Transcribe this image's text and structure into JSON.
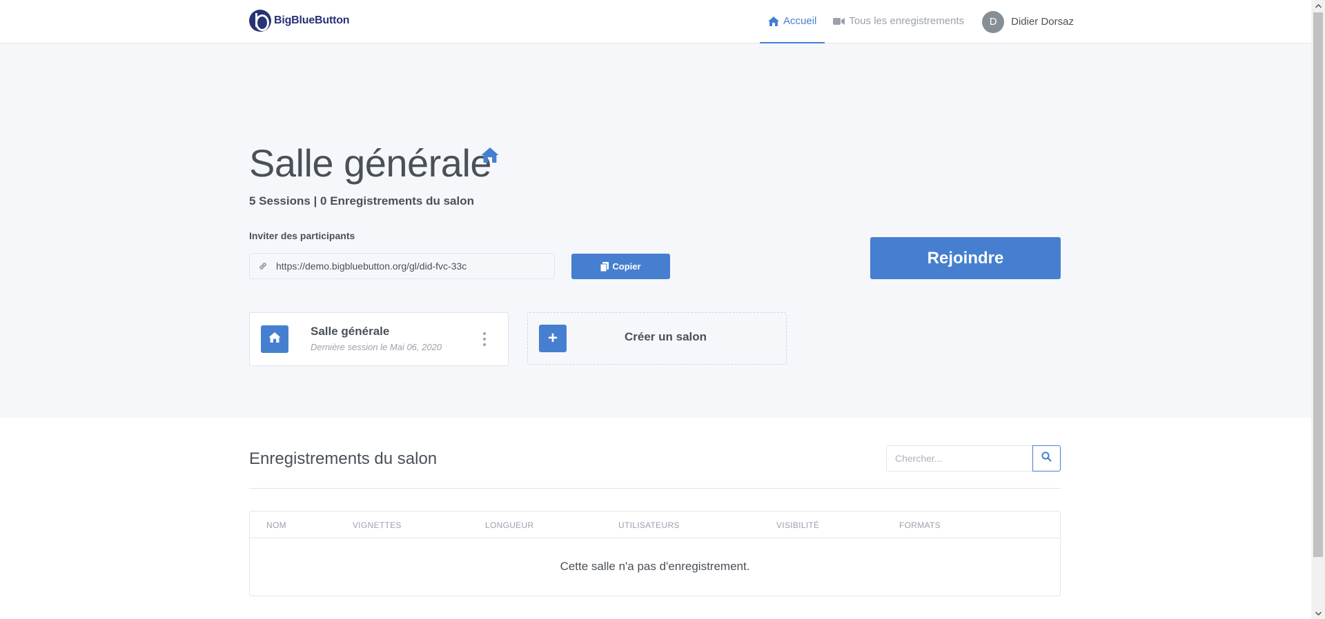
{
  "brand": {
    "name": "BigBlueButton"
  },
  "nav": {
    "home_label": "Accueil",
    "recordings_label": "Tous les enregistrements",
    "user_initial": "D",
    "user_name": "Didier Dorsaz"
  },
  "room": {
    "title": "Salle générale",
    "stats": "5 Sessions | 0 Enregistrements du salon",
    "invite_label": "Inviter des participants",
    "invite_url": "https://demo.bigbluebutton.org/gl/did-fvc-33c",
    "copy_label": "Copier",
    "join_label": "Rejoindre"
  },
  "room_card": {
    "name": "Salle générale",
    "last_session": "Dernière session le Mai 06, 2020"
  },
  "create_room": {
    "label": "Créer un salon",
    "icon_glyph": "+"
  },
  "recordings": {
    "title": "Enregistrements du salon",
    "search_placeholder": "Chercher...",
    "columns": [
      "NOM",
      "VIGNETTES",
      "LONGUEUR",
      "UTILISATEURS",
      "VISIBILITÉ",
      "FORMATS"
    ],
    "empty_message": "Cette salle n'a pas d'enregistrement."
  },
  "colors": {
    "accent": "#467fcf",
    "hero_bg": "#f5f7fb",
    "text": "#495057",
    "muted": "#9aa0ac"
  },
  "icons": [
    "bigbluebutton-logo",
    "home-icon",
    "video-camera-icon",
    "link-icon",
    "copy-icon",
    "kebab-menu-icon",
    "plus-icon",
    "search-icon"
  ]
}
